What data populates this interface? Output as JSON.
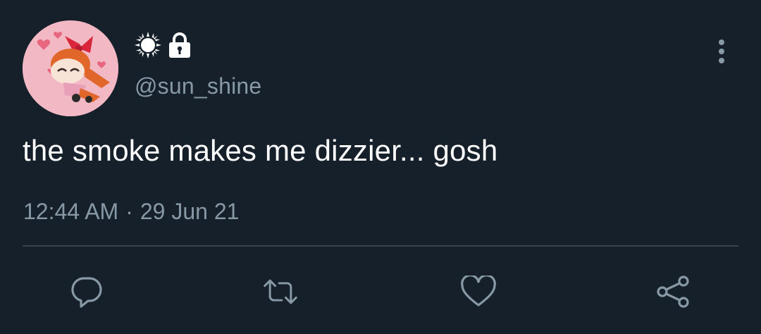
{
  "tweet": {
    "display_name_icons": [
      "sun-icon",
      "lock-icon"
    ],
    "handle": "@sun_shine",
    "text": "the smoke makes me dizzier... gosh",
    "time": "12:44 AM",
    "separator": "·",
    "date": "29 Jun 21"
  },
  "actions": [
    "reply-icon",
    "retweet-icon",
    "like-icon",
    "share-icon"
  ],
  "colors": {
    "background": "#15202b",
    "text": "#ffffff",
    "muted": "#8899a6",
    "divider": "#38444d",
    "avatar_bg": "#f2b8c4"
  }
}
